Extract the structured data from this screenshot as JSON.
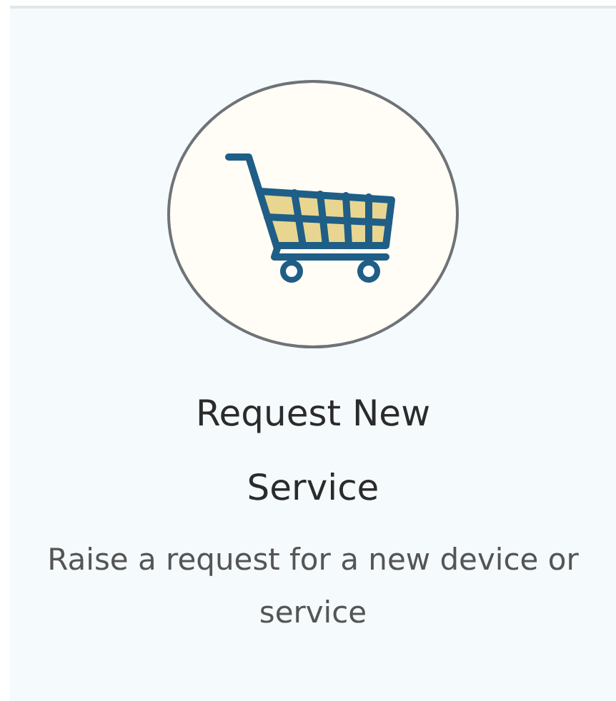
{
  "card": {
    "title": "Request New Service",
    "description": "Raise a request for a new device or service"
  }
}
